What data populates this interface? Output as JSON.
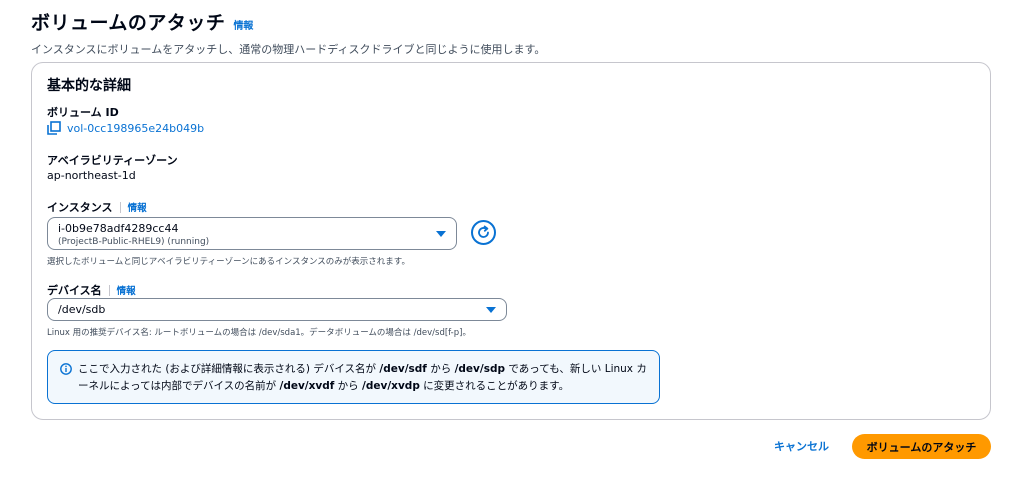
{
  "header": {
    "title": "ボリュームのアタッチ",
    "info": "情報",
    "description": "インスタンスにボリュームをアタッチし、通常の物理ハードディスクドライブと同じように使用します。"
  },
  "panel": {
    "title": "基本的な詳細",
    "volume_id_label": "ボリューム ID",
    "volume_id": "vol-0cc198965e24b049b",
    "az_label": "アベイラビリティーゾーン",
    "az_value": "ap-northeast-1d",
    "instance_label": "インスタンス",
    "instance_info": "情報",
    "instance_selected": "i-0b9e78adf4289cc44",
    "instance_sub": "(ProjectB-Public-RHEL9) (running)",
    "instance_hint": "選択したボリュームと同じアベイラビリティーゾーンにあるインスタンスのみが表示されます。",
    "device_label": "デバイス名",
    "device_info": "情報",
    "device_selected": "/dev/sdb",
    "device_hint": "Linux 用の推奨デバイス名: ルートボリュームの場合は /dev/sda1。データボリュームの場合は /dev/sd[f-p]。"
  },
  "alert": {
    "t1": "ここで入力された (および詳細情報に表示される) デバイス名が ",
    "b1": "/dev/sdf",
    "t2": " から ",
    "b2": "/dev/sdp",
    "t3": " であっても、新しい Linux カーネルによっては内部でデバイスの名前が ",
    "b3": "/dev/xvdf",
    "t4": " から ",
    "b4": "/dev/xvdp",
    "t5": " に変更されることがあります。"
  },
  "footer": {
    "cancel": "キャンセル",
    "attach": "ボリュームのアタッチ"
  },
  "colors": {
    "link": "#0972d3",
    "primary_button": "#ff9900",
    "alert_bg": "#f2f8fd"
  },
  "icons": [
    "copy-icon",
    "caret-down-icon",
    "refresh-icon",
    "info-circle-icon"
  ]
}
